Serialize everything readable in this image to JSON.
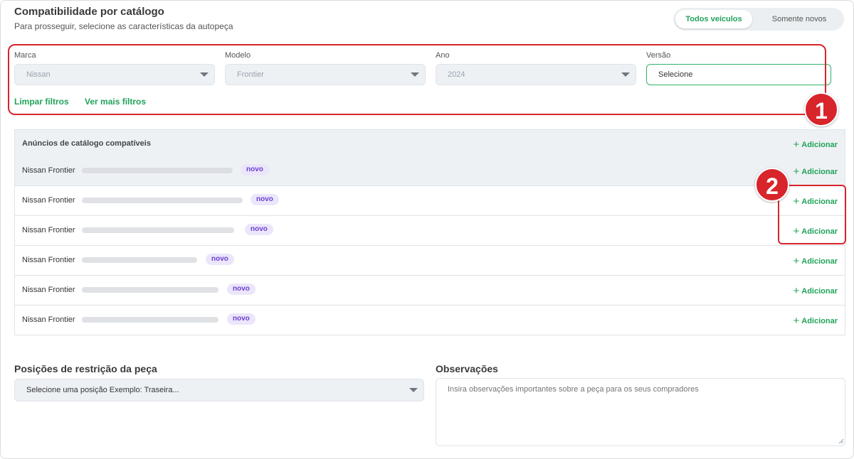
{
  "header": {
    "title": "Compatibilidade por catálogo",
    "subtitle": "Para prosseguir, selecione as características da autopeça"
  },
  "toggle": {
    "options": [
      "Todos veículos",
      "Somente novos"
    ],
    "selected": "Todos veículos"
  },
  "filters": {
    "marca": {
      "label": "Marca",
      "value": "Nissan"
    },
    "modelo": {
      "label": "Modelo",
      "value": "Frontier"
    },
    "ano": {
      "label": "Ano",
      "value": "2024"
    },
    "versao": {
      "label": "Versão",
      "value": "Selecione"
    },
    "clear_label": "Limpar filtros",
    "more_label": "Ver mais filtros"
  },
  "annotations": {
    "badge1": "1",
    "badge2": "2"
  },
  "table": {
    "header": "Anúncios de catálogo compatíveis",
    "add_label": "Adicionar",
    "rows": [
      {
        "name": "Nissan Frontier",
        "badge": "novo"
      },
      {
        "name": "Nissan Frontier",
        "badge": "novo"
      },
      {
        "name": "Nissan Frontier",
        "badge": "novo"
      },
      {
        "name": "Nissan Frontier",
        "badge": "novo"
      },
      {
        "name": "Nissan Frontier",
        "badge": "novo"
      },
      {
        "name": "Nissan Frontier",
        "badge": "novo"
      }
    ]
  },
  "restrictions": {
    "title": "Posições de restrição da peça",
    "placeholder": "Selecione uma posição Exemplo: Traseira..."
  },
  "observations": {
    "title": "Observações",
    "placeholder": "Insira observações importantes sobre a peça para os seus compradores"
  },
  "colors": {
    "accent": "#21a35a",
    "annotation": "#d8242b",
    "badge_bg": "#ece6fb",
    "badge_text": "#6a3fd0"
  }
}
